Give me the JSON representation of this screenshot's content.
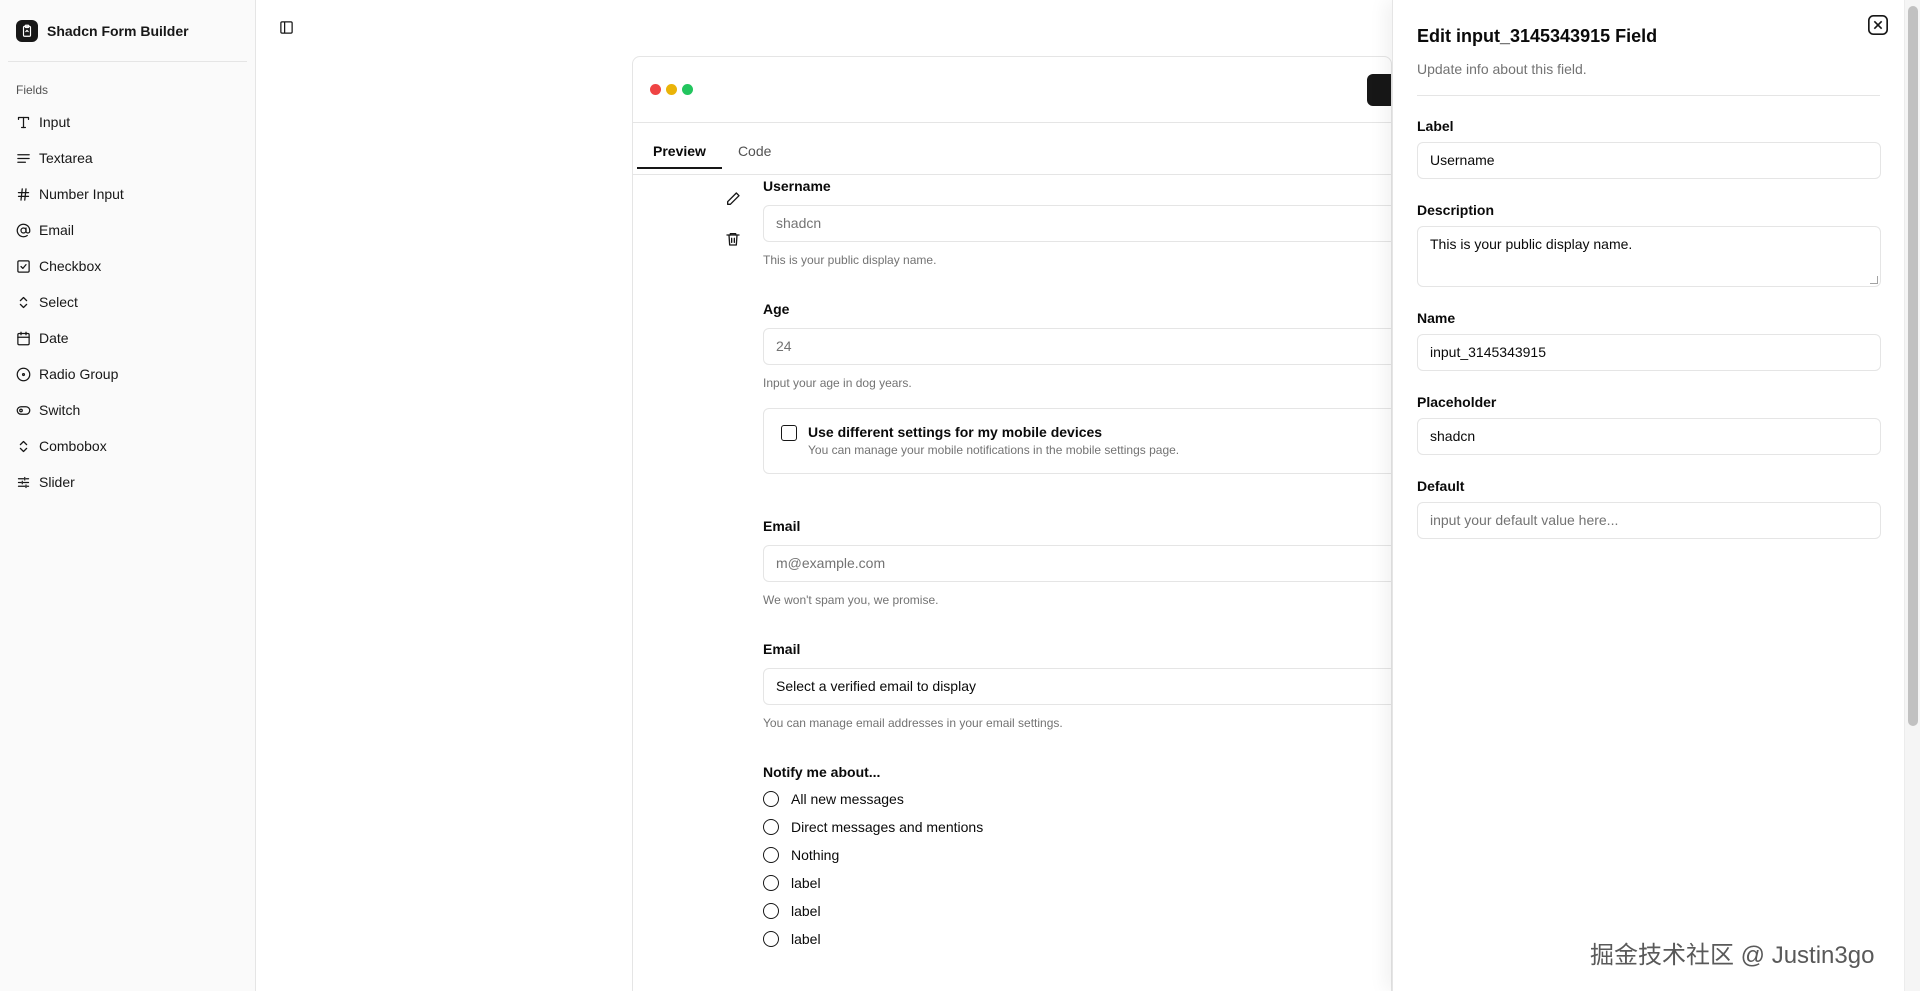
{
  "sidebar": {
    "brand": "Shadcn Form Builder",
    "group_label": "Fields",
    "items": [
      {
        "label": "Input",
        "icon": "type-icon"
      },
      {
        "label": "Textarea",
        "icon": "text-lines-icon"
      },
      {
        "label": "Number Input",
        "icon": "hash-icon"
      },
      {
        "label": "Email",
        "icon": "at-sign-icon"
      },
      {
        "label": "Checkbox",
        "icon": "square-check-icon"
      },
      {
        "label": "Select",
        "icon": "chevrons-up-down-icon"
      },
      {
        "label": "Date",
        "icon": "calendar-icon"
      },
      {
        "label": "Radio Group",
        "icon": "circle-dot-icon"
      },
      {
        "label": "Switch",
        "icon": "toggle-icon"
      },
      {
        "label": "Combobox",
        "icon": "chevrons-up-down-icon"
      },
      {
        "label": "Slider",
        "icon": "sliders-icon"
      }
    ]
  },
  "preview": {
    "tabs": [
      "Preview",
      "Code"
    ],
    "active_tab": "Preview",
    "window_dot_colors": [
      "#ef4444",
      "#eab308",
      "#22c55e"
    ],
    "username": {
      "label": "Username",
      "placeholder": "shadcn",
      "description": "This is your public display name."
    },
    "age": {
      "label": "Age",
      "placeholder": "24",
      "description": "Input your age in dog years."
    },
    "mobile": {
      "label": "Use different settings for my mobile devices",
      "description": "You can manage your mobile notifications in the mobile settings page."
    },
    "email": {
      "label": "Email",
      "placeholder": "m@example.com",
      "description": "We won't spam you, we promise."
    },
    "email_select": {
      "label": "Email",
      "value": "Select a verified email to display",
      "description": "You can manage email addresses in your email settings."
    },
    "notify": {
      "label": "Notify me about...",
      "options": [
        "All new messages",
        "Direct messages and mentions",
        "Nothing",
        "label",
        "label",
        "label"
      ]
    }
  },
  "panel": {
    "title": "Edit input_3145343915 Field",
    "subtitle": "Update info about this field.",
    "fields": {
      "label": {
        "label": "Label",
        "value": "Username"
      },
      "description": {
        "label": "Description",
        "value": "This is your public display name."
      },
      "name": {
        "label": "Name",
        "value": "input_3145343915"
      },
      "placeholder": {
        "label": "Placeholder",
        "value": "shadcn"
      },
      "default": {
        "label": "Default",
        "placeholder": "input your default value here..."
      }
    }
  },
  "watermark": "掘金技术社区 @ Justin3go"
}
